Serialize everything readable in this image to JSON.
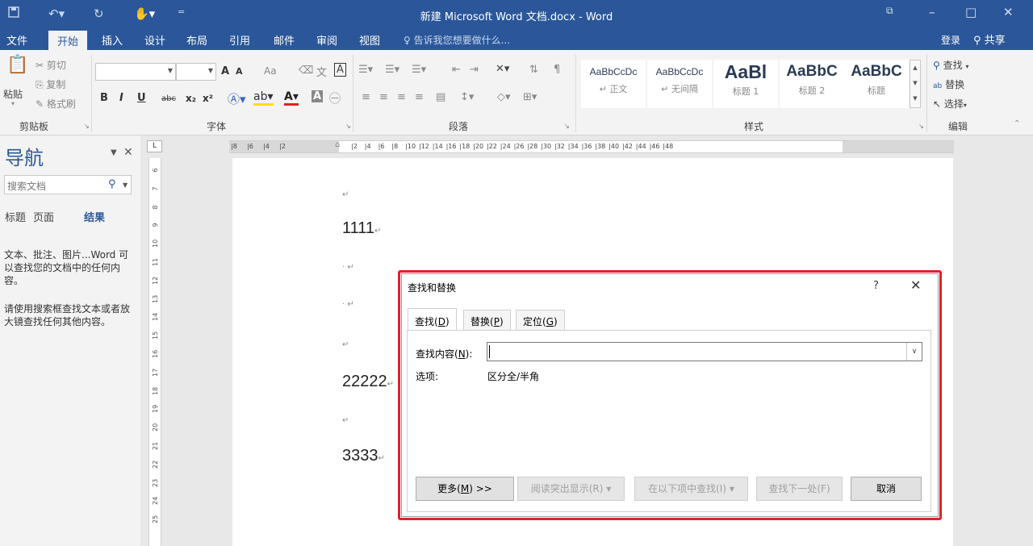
{
  "window": {
    "title": "新建 Microsoft Word 文档.docx - Word",
    "save_icon": "save-icon",
    "restore_icon": "ribbon-display-icon",
    "minimize": "–",
    "maximize": "□",
    "close": "✕"
  },
  "tabs": {
    "file": "文件",
    "home": "开始",
    "insert": "插入",
    "design": "设计",
    "layout": "布局",
    "references": "引用",
    "mailings": "邮件",
    "review": "审阅",
    "view": "视图",
    "tell_me": "告诉我您想要做什么...",
    "login": "登录",
    "share": "共享"
  },
  "ribbon": {
    "clipboard": {
      "label": "剪贴板",
      "paste": "粘贴",
      "cut": "剪切",
      "copy": "复制",
      "format_painter": "格式刷"
    },
    "font": {
      "label": "字体",
      "bold": "B",
      "italic": "I",
      "underline": "U",
      "strike": "abc",
      "subscript": "x₂",
      "superscript": "x²",
      "grow": "A",
      "shrink": "A",
      "case": "Aa",
      "char_border": "A",
      "phonetic": "文"
    },
    "paragraph": {
      "label": "段落"
    },
    "styles": {
      "label": "样式",
      "items": [
        {
          "sample": "AaBbCcDc",
          "name": "↵ 正文"
        },
        {
          "sample": "AaBbCcDc",
          "name": "↵ 无间隔"
        },
        {
          "sample": "AaBl",
          "name": "标题 1"
        },
        {
          "sample": "AaBbC",
          "name": "标题 2"
        },
        {
          "sample": "AaBbC",
          "name": "标题"
        }
      ]
    },
    "editing": {
      "label": "编辑",
      "find": "查找",
      "replace": "替换",
      "select": "选择"
    }
  },
  "navigation": {
    "title": "导航",
    "search_placeholder": "搜索文档",
    "tabs": {
      "headings": "标题",
      "pages": "页面",
      "results": "结果"
    },
    "info1": "文本、批注、图片...Word 可以查找您的文档中的任何内容。",
    "info2": "请使用搜索框查找文本或者放大镜查找任何其他内容。"
  },
  "ruler": {
    "corner": "L",
    "h_left": [
      "8",
      "6",
      "4",
      "2"
    ],
    "h_right": [
      "2",
      "4",
      "6",
      "8",
      "10",
      "12",
      "14",
      "16",
      "18",
      "20",
      "22",
      "24",
      "26",
      "28",
      "30",
      "32",
      "34",
      "36",
      "38",
      "40",
      "42",
      "44",
      "46",
      "48"
    ],
    "v": [
      "6",
      "7",
      "8",
      "9",
      "10",
      "11",
      "12",
      "13",
      "14",
      "15",
      "16",
      "17",
      "18",
      "19",
      "20",
      "21",
      "22",
      "23",
      "24",
      "25"
    ]
  },
  "document": {
    "lines": [
      "1111",
      "22222",
      "3333"
    ],
    "return_mark": "↵",
    "bullet_mark": "·"
  },
  "dialog": {
    "title": "查找和替换",
    "help": "?",
    "close": "✕",
    "tabs": {
      "find": "查找(",
      "find_key": "D",
      "replace": "替换(",
      "replace_key": "P",
      "goto": "定位(",
      "goto_key": "G",
      "close_paren": ")"
    },
    "find_label": "查找内容(",
    "find_label_key": "N",
    "find_label_end": "):",
    "find_value": "",
    "options_label": "选项:",
    "options_value": "区分全/半角",
    "buttons": {
      "more": "更多(",
      "more_key": "M",
      "more_end": ") >>",
      "reading_highlight": "阅读突出显示(R) ▾",
      "find_in": "在以下项中查找(I) ▾",
      "find_next": "查找下一处(F)",
      "cancel": "取消"
    }
  }
}
